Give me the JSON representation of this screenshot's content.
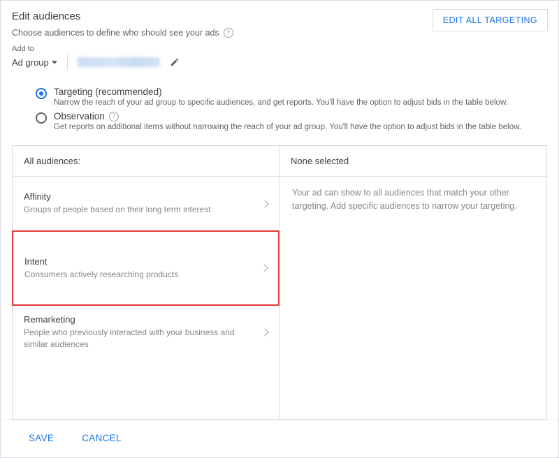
{
  "header": {
    "title": "Edit audiences",
    "subtitle": "Choose audiences to define who should see your ads",
    "edit_all_label": "EDIT ALL TARGETING"
  },
  "add_to": {
    "label": "Add to",
    "value": "Ad group"
  },
  "targeting_options": [
    {
      "title": "Targeting (recommended)",
      "desc": "Narrow the reach of your ad group to specific audiences, and get reports. You'll have the option to adjust bids in the table below.",
      "selected": true
    },
    {
      "title": "Observation",
      "desc": "Get reports on additional items without narrowing the reach of your ad group. You'll have the option to adjust bids in the table below.",
      "selected": false
    }
  ],
  "left_panel": {
    "header": "All audiences:",
    "categories": [
      {
        "title": "Affinity",
        "desc": "Groups of people based on their long term interest"
      },
      {
        "title": "Intent",
        "desc": "Consumers actively researching products"
      },
      {
        "title": "Remarketing",
        "desc": "People who previously interacted with your business and similar audiences"
      }
    ]
  },
  "right_panel": {
    "header": "None selected",
    "note": "Your ad can show to all audiences that match your other targeting. Add specific audiences to narrow your targeting."
  },
  "footer": {
    "save": "SAVE",
    "cancel": "CANCEL"
  }
}
